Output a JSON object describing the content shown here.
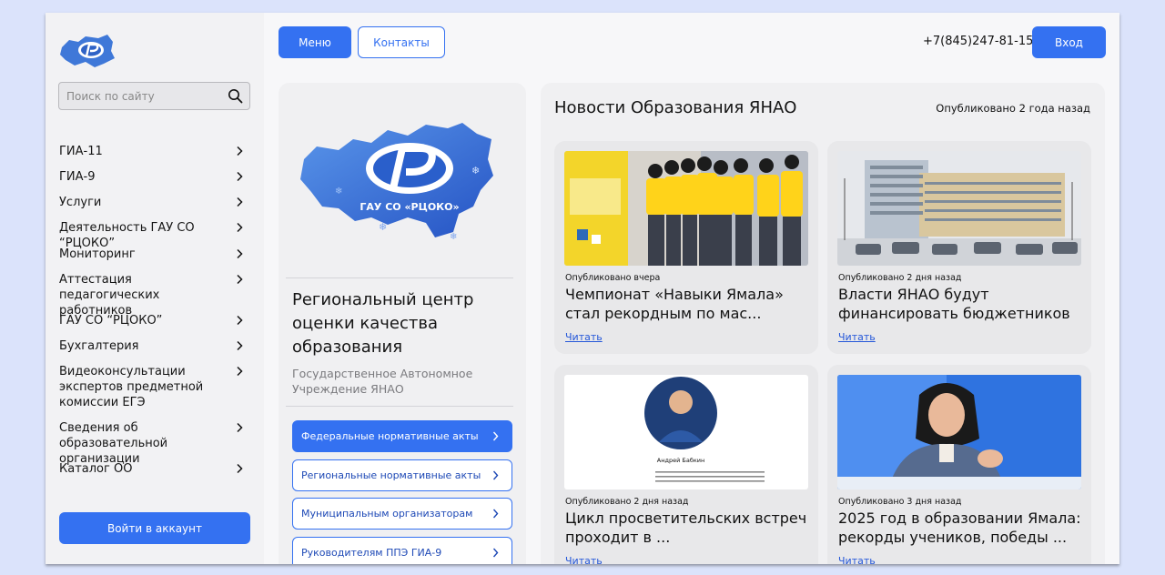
{
  "sidebar": {
    "logo_icon": "rcoko-logo",
    "search": {
      "placeholder": "Поиск по сайту"
    },
    "items": [
      {
        "label": "ГИА-11"
      },
      {
        "label": "ГИА-9"
      },
      {
        "label": "Услуги"
      },
      {
        "label": "Деятельность ГАУ СО “РЦОКО”"
      },
      {
        "label": "Мониторинг"
      },
      {
        "label": "Аттестация педагогических работников"
      },
      {
        "label": "ГАУ СО “РЦОКО”"
      },
      {
        "label": "Бухгалтерия"
      },
      {
        "label": "Видеоконсультации экспертов предметной комиссии ЕГЭ"
      },
      {
        "label": "Сведения об образовательной организации"
      },
      {
        "label": "Каталог ОО"
      }
    ],
    "login_label": "Войти в аккаунт"
  },
  "header": {
    "menu_label": "Меню",
    "contacts_label": "Контакты",
    "phone": "+7(845)247-81-15",
    "login_label": "Вход"
  },
  "org": {
    "logo_text": "ГАУ СО «РЦОКО»",
    "title": "Региональный центр оценки качества образования",
    "subtitle": "Государственное Автономное Учреждение ЯНАО",
    "links": [
      {
        "label": "Федеральные нормативные акты"
      },
      {
        "label": "Региональные нормативные акты"
      },
      {
        "label": "Муниципальным организаторам"
      },
      {
        "label": "Руководителям ППЭ ГИА-9"
      }
    ]
  },
  "news": {
    "title": "Новости Образования ЯНАО",
    "published": "Опубликовано 2 года назад",
    "read_label": "Читать",
    "cards": [
      {
        "date": "Опубликовано вчера",
        "headline": "Чемпионат «Навыки Ямала» стал рекордным по мас..."
      },
      {
        "date": "Опубликовано 2 дня назад",
        "headline": "Власти ЯНАО будут финансировать бюджетников"
      },
      {
        "date": "Опубликовано 2 дня назад",
        "headline": "Цикл просветительских встреч проходит в ...",
        "image_caption": "Андрей Бабкин"
      },
      {
        "date": "Опубликовано 3 дня назад",
        "headline": "2025 год в образовании Ямала: рекорды учеников, победы ..."
      }
    ]
  },
  "colors": {
    "accent": "#3471f1",
    "sidebar_bg": "#f2f2f4",
    "card_bg": "#f0f0f2",
    "page_bg": "#dbe3fb"
  }
}
